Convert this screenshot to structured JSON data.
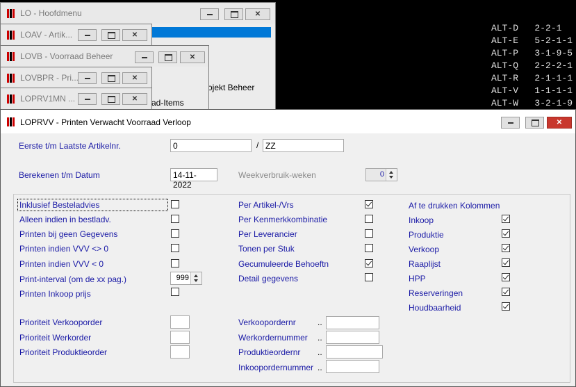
{
  "terminal": {
    "lines": [
      {
        "key": "ALT-D",
        "value": "2-2-1"
      },
      {
        "key": "ALT-E",
        "value": "5-2-1-1"
      },
      {
        "key": "ALT-P",
        "value": "3-1-9-5"
      },
      {
        "key": "ALT-Q",
        "value": "2-2-2-1"
      },
      {
        "key": "ALT-R",
        "value": "2-1-1-1"
      },
      {
        "key": "ALT-V",
        "value": "1-1-1-1"
      },
      {
        "key": "ALT-W",
        "value": "3-2-1-9"
      }
    ]
  },
  "bg_windows": {
    "lo": {
      "title": "LO - Hoofdmenu",
      "menu_item": "ojekt Beheer"
    },
    "loav": {
      "title": "LOAV - Artik..."
    },
    "lovb": {
      "title": "LOVB - Voorraad Beheer"
    },
    "lovbpr": {
      "title": "LOVBPR - Pri..."
    },
    "loprv1mn": {
      "title": "LOPRV1MN ...",
      "menu_item": "ad-Items"
    }
  },
  "dialog": {
    "title": "LOPRVV - Printen Verwacht Voorraad Verloop",
    "artikel_label": "Eerste t/m Laatste Artikelnr.",
    "artikel_from": "0",
    "artikel_sep": "/",
    "artikel_to": "ZZ",
    "datum_label": "Berekenen t/m Datum",
    "datum_value": "14-11-2022",
    "weekverbruik_label": "Weekverbruik-weken",
    "weekverbruik_value": "0",
    "left_options": [
      {
        "label": "Inklusief Besteladvies",
        "checked": false
      },
      {
        "label": "Alleen indien in bestladv.",
        "checked": false
      },
      {
        "label": "Printen bij geen Gegevens",
        "checked": false
      },
      {
        "label": "Printen indien VVV <> 0",
        "checked": false
      },
      {
        "label": "Printen indien VVV < 0",
        "checked": false
      },
      {
        "label": "Print-interval (om de xx pag.)",
        "value": "999"
      },
      {
        "label": "Printen Inkoop prijs",
        "checked": false
      }
    ],
    "mid_options": [
      {
        "label": "Per Artikel-/Vrs",
        "checked": true
      },
      {
        "label": "Per Kenmerkkombinatie",
        "checked": false
      },
      {
        "label": "Per Leverancier",
        "checked": false
      },
      {
        "label": "Tonen per Stuk",
        "checked": false
      },
      {
        "label": "Gecumuleerde Behoeftn",
        "checked": true
      },
      {
        "label": "Detail gegevens",
        "checked": false
      }
    ],
    "columns_header": "Af te drukken Kolommen",
    "columns": [
      {
        "label": "Inkoop",
        "checked": true
      },
      {
        "label": "Produktie",
        "checked": true
      },
      {
        "label": "Verkoop",
        "checked": true
      },
      {
        "label": "Raaplijst",
        "checked": true
      },
      {
        "label": "HPP",
        "checked": true
      },
      {
        "label": "Reserveringen",
        "checked": true
      },
      {
        "label": "Houdbaarheid",
        "checked": true
      }
    ],
    "priorities": [
      {
        "label": "Prioriteit Verkooporder",
        "value": ""
      },
      {
        "label": "Prioriteit Werkorder",
        "value": ""
      },
      {
        "label": "Prioriteit Produktieorder",
        "value": ""
      }
    ],
    "order_fields": [
      {
        "label": "Verkoopordernr",
        "dots": "..",
        "value": ""
      },
      {
        "label": "Werkordernummer",
        "dots": "..",
        "value": ""
      },
      {
        "label": "Produktieordernr",
        "dots": "..",
        "value": ""
      },
      {
        "label": "Inkoopordernummer",
        "dots": "..",
        "value": ""
      }
    ]
  }
}
